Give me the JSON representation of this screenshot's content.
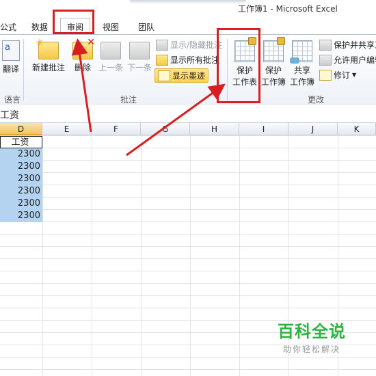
{
  "window": {
    "title": "工作簿1 - Microsoft Excel"
  },
  "tabs": [
    {
      "label": "公式"
    },
    {
      "label": "数据"
    },
    {
      "label": "审阅"
    },
    {
      "label": "视图"
    },
    {
      "label": "团队"
    }
  ],
  "ribbon": {
    "language": {
      "translate": "翻译",
      "group_label": "语言"
    },
    "comments": {
      "new_comment": "新建批注",
      "delete": "删除",
      "previous": "上一条",
      "next": "下一条",
      "show_hide": "显示/隐藏批注",
      "show_all": "显示所有批注",
      "show_ink": "显示墨迹",
      "group_label": "批注"
    },
    "changes": {
      "protect_sheet_line1": "保护",
      "protect_sheet_line2": "工作表",
      "protect_workbook_line1": "保护",
      "protect_workbook_line2": "工作簿",
      "share_workbook_line1": "共享",
      "share_workbook_line2": "工作簿",
      "protect_share": "保护并共享工",
      "allow_edit": "允许用户编辑",
      "track_changes": "修订",
      "group_label": "更改"
    }
  },
  "formula_bar": {
    "value": "工资"
  },
  "columns": [
    "D",
    "E",
    "F",
    "G",
    "H",
    "I",
    "J",
    "K"
  ],
  "sheet": {
    "header_cell": "工资",
    "values": [
      "2300",
      "2300",
      "2300",
      "2300",
      "2300",
      "2300"
    ]
  },
  "watermark": {
    "title": "百科全说",
    "subtitle": "助你轻松解决"
  },
  "colors": {
    "highlight_red": "#d81e1e",
    "selection_blue": "#b3d3f1",
    "watermark_green": "#2db33f"
  }
}
